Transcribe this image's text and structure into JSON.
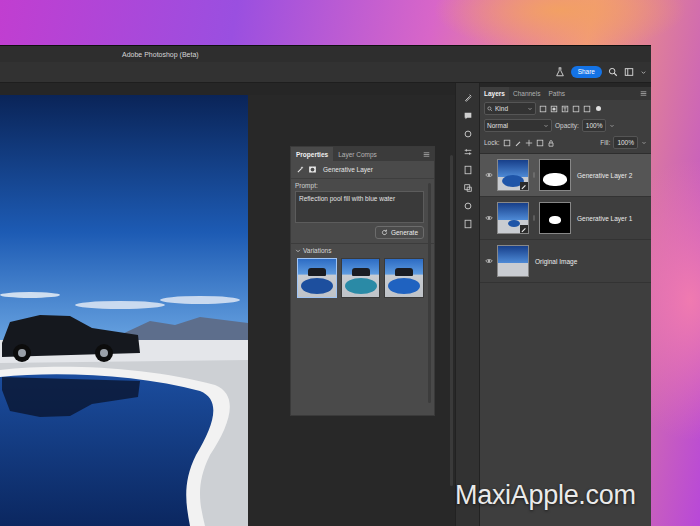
{
  "window": {
    "title": "Adobe Photoshop (Beta)"
  },
  "toolbar": {
    "share": "Share"
  },
  "properties": {
    "tabs": [
      {
        "label": "Properties",
        "selected": true
      },
      {
        "label": "Layer Comps",
        "selected": false
      }
    ],
    "layer_type": "Generative Layer",
    "prompt_label": "Prompt:",
    "prompt": "Reflection pool fill with blue water",
    "generate": "Generate",
    "variations_label": "Variations",
    "variations": [
      {
        "selected": true
      },
      {
        "selected": false
      },
      {
        "selected": false
      }
    ]
  },
  "layers_panel": {
    "tabs": [
      {
        "label": "Layers",
        "selected": true
      },
      {
        "label": "Channels",
        "selected": false
      },
      {
        "label": "Paths",
        "selected": false
      }
    ],
    "filter": "Kind",
    "blend_mode": "Normal",
    "opacity_label": "Opacity:",
    "opacity": "100%",
    "lock_label": "Lock:",
    "fill_label": "Fill:",
    "fill": "100%",
    "layers": [
      {
        "name": "Generative Layer 2",
        "selected": true,
        "visible": true,
        "has_mask": true
      },
      {
        "name": "Generative Layer 1",
        "selected": false,
        "visible": true,
        "has_mask": true
      },
      {
        "name": "Original Image",
        "selected": false,
        "visible": true,
        "has_mask": false
      }
    ]
  },
  "watermark": "MaxiApple.com"
}
